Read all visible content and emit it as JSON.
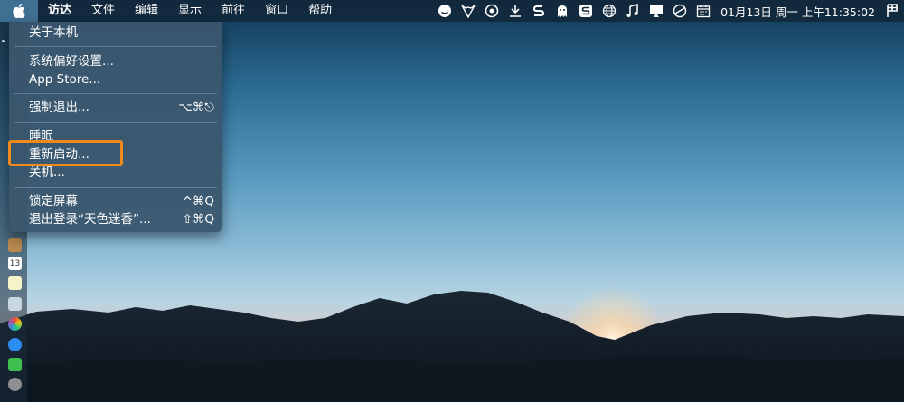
{
  "menubar": {
    "apple_icon": "apple-logo",
    "items": [
      "访达",
      "文件",
      "编辑",
      "显示",
      "前往",
      "窗口",
      "帮助"
    ],
    "status_icons": [
      "cloud-smile-icon",
      "fox-icon",
      "sync-icon",
      "download-icon",
      "s-app-icon",
      "ghost-icon",
      "sogou-s-icon",
      "globe-icon",
      "music-icon",
      "display-icon",
      "clock-icon",
      "calendar-icon",
      "flag-icon"
    ],
    "clock": "01月13日 周一 上午11:35:02"
  },
  "apple_menu": {
    "items": [
      {
        "label": "关于本机",
        "shortcut": ""
      },
      {
        "label": "系统偏好设置...",
        "shortcut": ""
      },
      {
        "label": "App Store...",
        "shortcut": ""
      },
      {
        "label": "强制退出...",
        "shortcut": "⌥⌘⎋"
      },
      {
        "label": "睡眠",
        "shortcut": ""
      },
      {
        "label": "重新启动...",
        "shortcut": ""
      },
      {
        "label": "关机...",
        "shortcut": ""
      },
      {
        "label": "锁定屏幕",
        "shortcut": "^⌘Q"
      },
      {
        "label": "退出登录“天色迷香”...",
        "shortcut": "⇧⌘Q"
      }
    ]
  },
  "dock": {
    "calendar_day": "13"
  },
  "colors": {
    "highlight": "#f08a1c",
    "menubar_bg": "#12283c",
    "apple_box_bg": "#3f6f93"
  }
}
